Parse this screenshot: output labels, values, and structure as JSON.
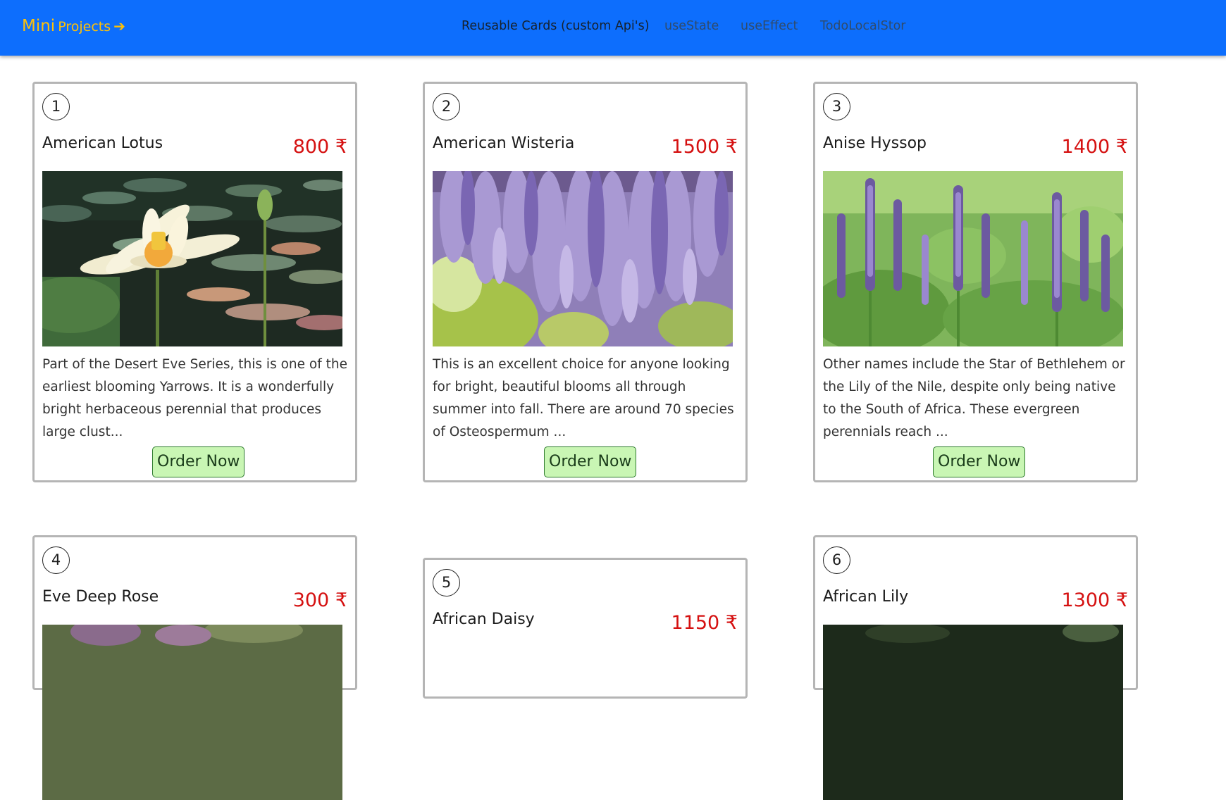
{
  "navbar": {
    "brand_word1": "Mini",
    "brand_word2": "Projects",
    "brand_arrow": "➔",
    "links": [
      {
        "label": "Reusable Cards (custom Api's)",
        "active": true
      },
      {
        "label": "useState",
        "active": false
      },
      {
        "label": "useEffect",
        "active": false
      },
      {
        "label": "TodoLocalStor",
        "active": false
      }
    ]
  },
  "colors": {
    "navbar": "#0d6efd",
    "brand": "#ffc107",
    "price": "#d51010",
    "button_bg": "#c9f6b4"
  },
  "cards": [
    {
      "number": "1",
      "name": "American Lotus",
      "price": "800 ₹",
      "image": "lotus-flower-photo",
      "description": "Part of the Desert Eve Series, this is one of the earliest blooming Yarrows. It is a wonderfully bright herbaceous perennial that produces large clust...",
      "button": "Order Now"
    },
    {
      "number": "2",
      "name": "American Wisteria",
      "price": "1500 ₹",
      "image": "wisteria-flower-photo",
      "description": "This is an excellent choice for anyone looking for bright, beautiful blooms all through summer into fall. There are around 70 species of Osteospermum ...",
      "button": "Order Now"
    },
    {
      "number": "3",
      "name": "Anise Hyssop",
      "price": "1400 ₹",
      "image": "hyssop-flower-photo",
      "description": "Other names include the Star of Bethlehem or the Lily of the Nile, despite only being native to the South of Africa. These evergreen perennials reach ...",
      "button": "Order Now"
    },
    {
      "number": "4",
      "name": "Eve Deep Rose",
      "price": "300 ₹",
      "image": "rose-flower-photo"
    },
    {
      "number": "5",
      "name": "African Daisy",
      "price": "1150 ₹"
    },
    {
      "number": "6",
      "name": "African Lily",
      "price": "1300 ₹",
      "image": "lily-flower-photo"
    }
  ]
}
